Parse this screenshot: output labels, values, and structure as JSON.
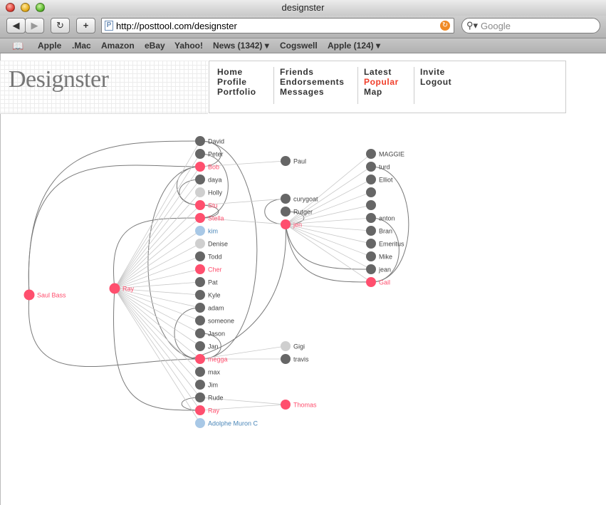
{
  "window": {
    "title": "designster"
  },
  "toolbar": {
    "back_label": "◀",
    "forward_label": "▶",
    "reload_label": "↻",
    "add_label": "+",
    "url": "http://posttool.com/designster",
    "search_placeholder": "Google"
  },
  "bookmarks": [
    "Apple",
    ".Mac",
    "Amazon",
    "eBay",
    "Yahoo!",
    "News (1342) ▾",
    "Cogswell",
    "Apple (124) ▾"
  ],
  "site": {
    "logo": "Designster",
    "nav": {
      "col1": [
        "Home",
        "Profile",
        "Portfolio"
      ],
      "col2": [
        "Friends",
        "Endorsements",
        "Messages"
      ],
      "col3": [
        "Latest",
        "Popular",
        "Map"
      ],
      "col4": [
        "Invite",
        "Logout"
      ],
      "active": "Popular"
    }
  },
  "colors": {
    "gray": "#666666",
    "pink": "#ff4f6e",
    "light": "#cfcfcf",
    "blue": "#a8c8e6",
    "edge": "#cccccc",
    "curve": "#777777"
  },
  "graph": {
    "nodes": [
      {
        "id": "saulbass",
        "label": "Saul Bass",
        "color": "pink"
      },
      {
        "id": "ray1",
        "label": "Ray",
        "color": "pink"
      },
      {
        "id": "david",
        "label": "David",
        "color": "gray"
      },
      {
        "id": "peter",
        "label": "Peter",
        "color": "gray"
      },
      {
        "id": "bob",
        "label": "Bob",
        "color": "pink"
      },
      {
        "id": "daya",
        "label": "daya",
        "color": "gray"
      },
      {
        "id": "holly",
        "label": "Holly",
        "color": "light"
      },
      {
        "id": "stu",
        "label": "Stu",
        "color": "pink"
      },
      {
        "id": "stella",
        "label": "Stella",
        "color": "pink"
      },
      {
        "id": "kim",
        "label": "kim",
        "color": "blue"
      },
      {
        "id": "denise",
        "label": "Denise",
        "color": "light"
      },
      {
        "id": "todd",
        "label": "Todd",
        "color": "gray"
      },
      {
        "id": "cher",
        "label": "Cher",
        "color": "pink"
      },
      {
        "id": "pat",
        "label": "Pat",
        "color": "gray"
      },
      {
        "id": "kyle",
        "label": "Kyle",
        "color": "gray"
      },
      {
        "id": "adam",
        "label": "adam",
        "color": "gray"
      },
      {
        "id": "someone",
        "label": "someone",
        "color": "gray"
      },
      {
        "id": "jason",
        "label": "Jason",
        "color": "gray"
      },
      {
        "id": "jan",
        "label": "Jan",
        "color": "gray"
      },
      {
        "id": "megga",
        "label": "megga",
        "color": "pink"
      },
      {
        "id": "max",
        "label": "max",
        "color": "gray"
      },
      {
        "id": "jim",
        "label": "Jim",
        "color": "gray"
      },
      {
        "id": "rude",
        "label": "Rude",
        "color": "gray"
      },
      {
        "id": "ray2",
        "label": "Ray",
        "color": "pink"
      },
      {
        "id": "adolphe",
        "label": "Adolphe Muron C",
        "color": "blue"
      },
      {
        "id": "paul",
        "label": "Paul",
        "color": "gray"
      },
      {
        "id": "curygoat",
        "label": "curygoat",
        "color": "gray"
      },
      {
        "id": "rutger",
        "label": "Rutger",
        "color": "gray"
      },
      {
        "id": "jen",
        "label": "jen",
        "color": "pink"
      },
      {
        "id": "gigi",
        "label": "Gigi",
        "color": "light"
      },
      {
        "id": "travis",
        "label": "travis",
        "color": "gray"
      },
      {
        "id": "thomas",
        "label": "Thomas",
        "color": "pink"
      },
      {
        "id": "maggie",
        "label": "MAGGIE",
        "color": "gray"
      },
      {
        "id": "turd",
        "label": "turd",
        "color": "gray"
      },
      {
        "id": "elliot",
        "label": "Elliot",
        "color": "gray"
      },
      {
        "id": "blank1",
        "label": "",
        "color": "gray"
      },
      {
        "id": "blank2",
        "label": "",
        "color": "gray"
      },
      {
        "id": "anton",
        "label": "anton",
        "color": "gray"
      },
      {
        "id": "bran",
        "label": "Bran",
        "color": "gray"
      },
      {
        "id": "emeritus",
        "label": "Emeritus",
        "color": "gray"
      },
      {
        "id": "mike",
        "label": "Mike",
        "color": "gray"
      },
      {
        "id": "jean",
        "label": "jean",
        "color": "gray"
      },
      {
        "id": "gail",
        "label": "Gail",
        "color": "pink"
      }
    ],
    "straight_edges": [
      [
        "ray1",
        "david"
      ],
      [
        "ray1",
        "peter"
      ],
      [
        "ray1",
        "bob"
      ],
      [
        "ray1",
        "daya"
      ],
      [
        "ray1",
        "holly"
      ],
      [
        "ray1",
        "stu"
      ],
      [
        "ray1",
        "stella"
      ],
      [
        "ray1",
        "kim"
      ],
      [
        "ray1",
        "denise"
      ],
      [
        "ray1",
        "todd"
      ],
      [
        "ray1",
        "cher"
      ],
      [
        "ray1",
        "pat"
      ],
      [
        "ray1",
        "kyle"
      ],
      [
        "ray1",
        "adam"
      ],
      [
        "ray1",
        "someone"
      ],
      [
        "ray1",
        "jason"
      ],
      [
        "ray1",
        "jan"
      ],
      [
        "ray1",
        "megga"
      ],
      [
        "ray1",
        "max"
      ],
      [
        "ray1",
        "jim"
      ],
      [
        "ray1",
        "rude"
      ],
      [
        "ray1",
        "ray2"
      ],
      [
        "ray1",
        "adolphe"
      ],
      [
        "bob",
        "paul"
      ],
      [
        "stella",
        "jen"
      ],
      [
        "stu",
        "curygoat"
      ],
      [
        "megga",
        "gigi"
      ],
      [
        "megga",
        "travis"
      ],
      [
        "ray2",
        "thomas"
      ],
      [
        "rude",
        "thomas"
      ],
      [
        "jen",
        "maggie"
      ],
      [
        "jen",
        "turd"
      ],
      [
        "jen",
        "elliot"
      ],
      [
        "jen",
        "blank1"
      ],
      [
        "jen",
        "blank2"
      ],
      [
        "jen",
        "anton"
      ],
      [
        "jen",
        "bran"
      ],
      [
        "jen",
        "emeritus"
      ],
      [
        "jen",
        "mike"
      ],
      [
        "jen",
        "jean"
      ],
      [
        "jen",
        "gail"
      ]
    ],
    "curved_edges": [
      [
        "saulbass",
        "david"
      ],
      [
        "saulbass",
        "megga"
      ],
      [
        "saulbass",
        "bob"
      ],
      [
        "ray1",
        "ray2"
      ],
      [
        "ray1",
        "stella"
      ],
      [
        "david",
        "bob"
      ],
      [
        "bob",
        "stu"
      ],
      [
        "peter",
        "stella"
      ],
      [
        "daya",
        "stu"
      ],
      [
        "stu",
        "stella"
      ],
      [
        "adam",
        "megga"
      ],
      [
        "jason",
        "megga"
      ],
      [
        "bob",
        "megga"
      ],
      [
        "david",
        "megga"
      ],
      [
        "curygoat",
        "jen"
      ],
      [
        "rutger",
        "jen"
      ],
      [
        "jen",
        "gail"
      ],
      [
        "jen",
        "jean"
      ],
      [
        "turd",
        "gail"
      ],
      [
        "anton",
        "gail"
      ],
      [
        "rude",
        "ray2"
      ],
      [
        "jen",
        "megga"
      ]
    ]
  }
}
